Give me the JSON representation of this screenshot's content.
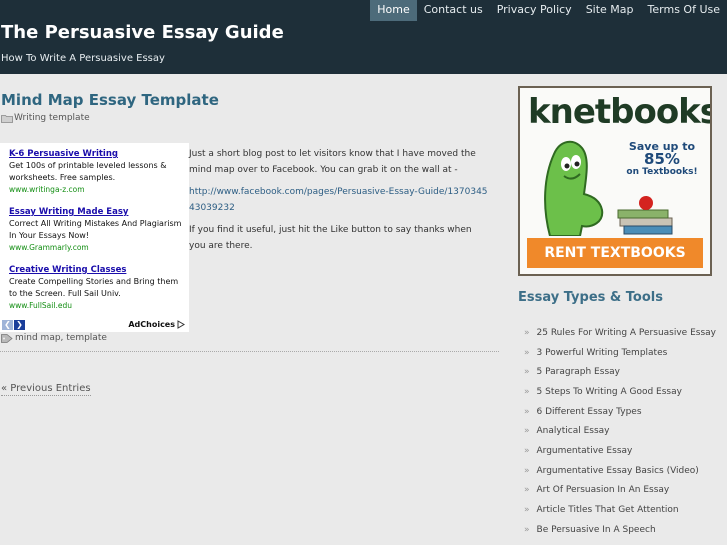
{
  "nav": {
    "items": [
      "Home",
      "Contact us",
      "Privacy Policy",
      "Site Map",
      "Terms Of Use"
    ],
    "active": "Home"
  },
  "site": {
    "title": "The Persuasive Essay Guide",
    "description": "How To Write A Persuasive Essay"
  },
  "post": {
    "title": "Mind Map Essay Template",
    "category": "Writing template",
    "body": {
      "p1": "Just a short blog post to let visitors know that I have moved the mind map over to Facebook.  You can grab it on the wall at -",
      "link": "http://www.facebook.com/pages/Persuasive-Essay-Guide/137034543039232",
      "p2": "If you find it useful, just hit the Like button to say thanks when you are there."
    },
    "tags": "mind map, template"
  },
  "ads": {
    "items": [
      {
        "title": "K-6 Persuasive Writing",
        "text": "Get 100s of printable leveled lessons & worksheets. Free samples.",
        "url": "www.writinga-z.com"
      },
      {
        "title": "Essay Writing Made Easy",
        "text": "Correct All Writing Mistakes And Plagiarism In Your Essays Now!",
        "url": "www.Grammarly.com"
      },
      {
        "title": "Creative Writing Classes",
        "text": "Create Compelling Stories and Bring them to the Screen. Full Sail Univ.",
        "url": "www.FullSail.edu"
      }
    ],
    "adchoices": "AdChoices"
  },
  "pagination": {
    "previous": "« Previous Entries"
  },
  "banner": {
    "logo": "knetbooks",
    "save_line1": "Save up to",
    "save_line2": "85%",
    "save_line3": "on Textbooks!",
    "cta": "RENT TEXTBOOKS",
    "colors": {
      "cta": "#f0892a",
      "mascot": "#6cc04a"
    }
  },
  "sidebar": {
    "title": "Essay Types & Tools",
    "items": [
      "25 Rules For Writing A Persuasive Essay",
      "3 Powerful Writing Templates",
      "5 Paragraph Essay",
      "5 Steps To Writing A Good Essay",
      "6 Different Essay Types",
      "Analytical Essay",
      "Argumentative Essay",
      "Argumentative Essay Basics (Video)",
      "Art Of Persuasion In An Essay",
      "Article Titles That Get Attention",
      "Be Persuasive In A Speech"
    ]
  }
}
